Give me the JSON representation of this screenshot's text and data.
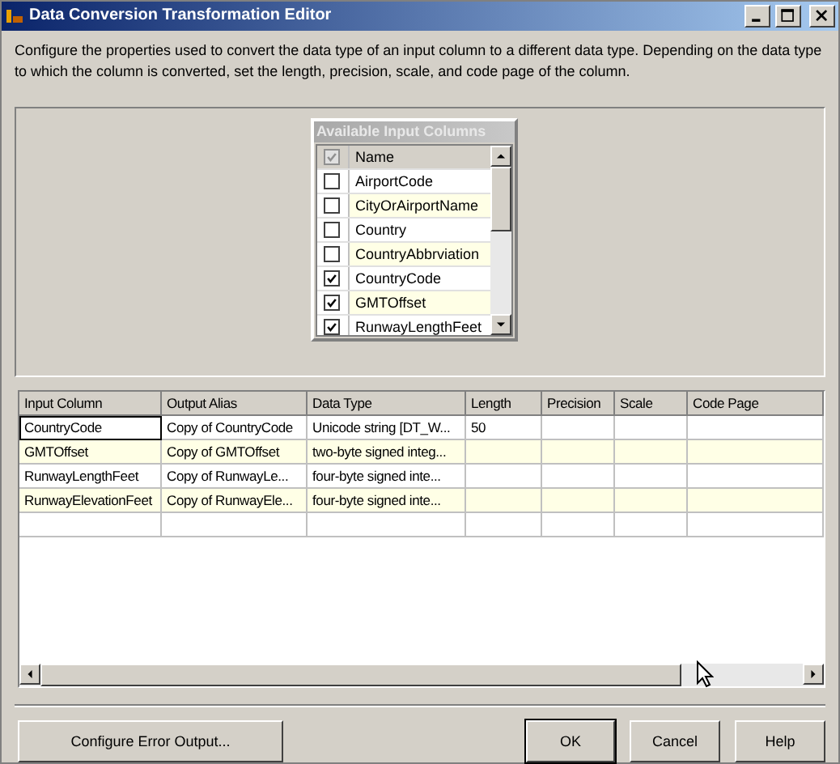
{
  "window": {
    "title": "Data Conversion Transformation Editor"
  },
  "description": "Configure the properties used to convert the data type of an input column to a different data type. Depending on the data type to which the column is converted, set the length, precision, scale, and code page of the column.",
  "available_columns": {
    "title": "Available Input Columns",
    "header_checked": true,
    "header": "Name",
    "items": [
      {
        "name": "AirportCode",
        "checked": false
      },
      {
        "name": "CityOrAirportName",
        "checked": false
      },
      {
        "name": "Country",
        "checked": false
      },
      {
        "name": "CountryAbbrviation",
        "checked": false
      },
      {
        "name": "CountryCode",
        "checked": true
      },
      {
        "name": "GMTOffset",
        "checked": true
      },
      {
        "name": "RunwayLengthFeet",
        "checked": true
      }
    ]
  },
  "table": {
    "columns": [
      "Input Column",
      "Output Alias",
      "Data Type",
      "Length",
      "Precision",
      "Scale",
      "Code Page"
    ],
    "rows": [
      {
        "selected": true,
        "cells": [
          "CountryCode",
          "Copy of CountryCode",
          "Unicode string [DT_W...",
          "50",
          "",
          "",
          ""
        ]
      },
      {
        "selected": false,
        "cells": [
          "GMTOffset",
          "Copy of GMTOffset",
          "two-byte signed integ...",
          "",
          "",
          "",
          ""
        ]
      },
      {
        "selected": false,
        "cells": [
          "RunwayLengthFeet",
          "Copy of RunwayLe...",
          "four-byte signed inte...",
          "",
          "",
          "",
          ""
        ]
      },
      {
        "selected": false,
        "cells": [
          "RunwayElevationFeet",
          "Copy of RunwayEle...",
          "four-byte signed inte...",
          "",
          "",
          "",
          ""
        ]
      }
    ]
  },
  "buttons": {
    "error_output": "Configure Error Output...",
    "ok": "OK",
    "cancel": "Cancel",
    "help": "Help"
  }
}
